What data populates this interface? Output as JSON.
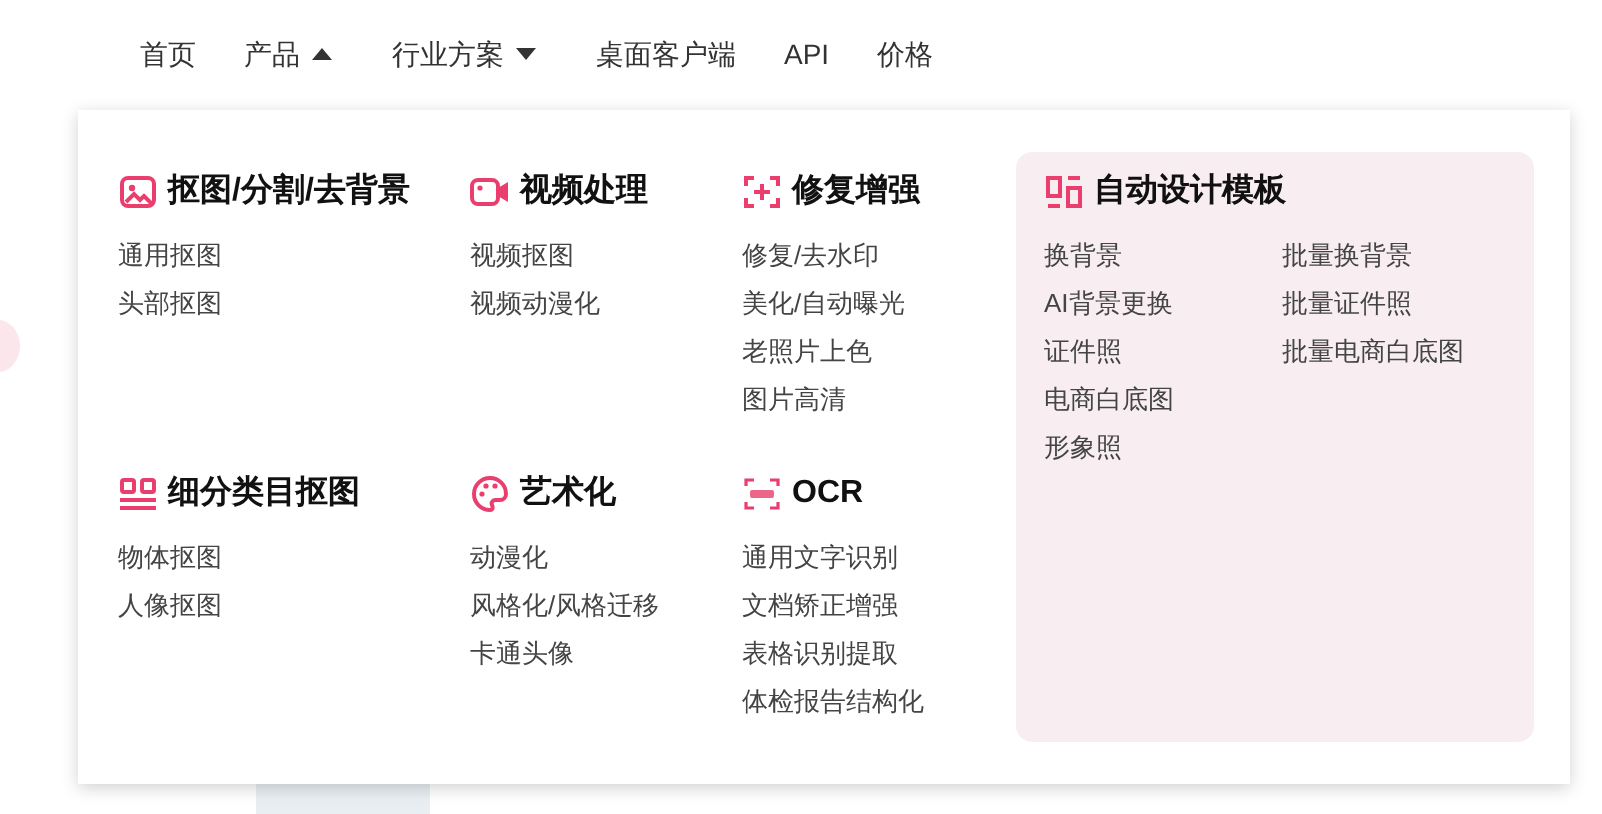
{
  "nav": [
    {
      "label": "首页",
      "kind": "link"
    },
    {
      "label": "产品",
      "kind": "dropdown",
      "expanded": true
    },
    {
      "label": "行业方案",
      "kind": "dropdown",
      "expanded": false
    },
    {
      "label": "桌面客户端",
      "kind": "link"
    },
    {
      "label": "API",
      "kind": "link"
    },
    {
      "label": "价格",
      "kind": "link"
    }
  ],
  "menu": {
    "groups": [
      {
        "title": "抠图/分割/去背景",
        "items": [
          "通用抠图",
          "头部抠图"
        ]
      },
      {
        "title": "视频处理",
        "items": [
          "视频抠图",
          "视频动漫化"
        ]
      },
      {
        "title": "修复增强",
        "items": [
          "修复/去水印",
          "美化/自动曝光",
          "老照片上色",
          "图片高清"
        ]
      },
      {
        "title": "细分类目抠图",
        "items": [
          "物体抠图",
          "人像抠图"
        ]
      },
      {
        "title": "艺术化",
        "items": [
          "动漫化",
          "风格化/风格迁移",
          "卡通头像"
        ]
      },
      {
        "title": "OCR",
        "items": [
          "通用文字识别",
          "文档矫正增强",
          "表格识别提取",
          "体检报告结构化"
        ]
      }
    ],
    "featured": {
      "title": "自动设计模板",
      "columns": [
        [
          "换背景",
          "AI背景更换",
          "证件照",
          "电商白底图",
          "形象照"
        ],
        [
          "批量换背景",
          "批量证件照",
          "批量电商白底图"
        ]
      ]
    }
  }
}
